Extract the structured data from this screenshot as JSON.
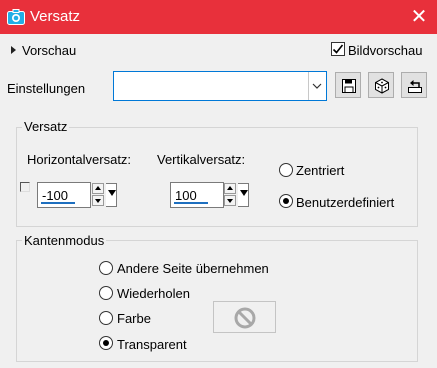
{
  "window": {
    "title": "Versatz",
    "accent_color": "#e8303b"
  },
  "preview": {
    "toggle_label": "Vorschau",
    "checkbox_label": "Bildvorschau",
    "checkbox_checked": true
  },
  "settings": {
    "label": "Einstellungen",
    "preset_value": ""
  },
  "toolbar": {
    "icons": [
      "save-icon",
      "random-dice-icon",
      "reset-icon"
    ]
  },
  "offset": {
    "group_label": "Versatz",
    "horizontal_label": "Horizontalversatz:",
    "horizontal_value": "-100",
    "vertical_label": "Vertikalversatz:",
    "vertical_value": "100",
    "options": [
      {
        "label": "Zentriert",
        "selected": false
      },
      {
        "label": "Benutzerdefiniert",
        "selected": true
      }
    ]
  },
  "edge_mode": {
    "group_label": "Kantenmodus",
    "options": [
      {
        "label": "Andere Seite übernehmen",
        "selected": false
      },
      {
        "label": "Wiederholen",
        "selected": false
      },
      {
        "label": "Farbe",
        "selected": false
      },
      {
        "label": "Transparent",
        "selected": true
      }
    ]
  }
}
